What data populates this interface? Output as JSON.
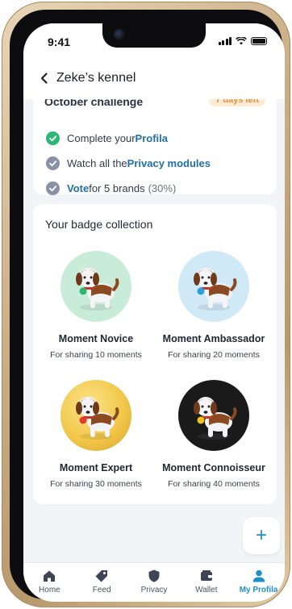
{
  "status_bar": {
    "time": "9:41"
  },
  "header": {
    "title": "Zeke’s kennel",
    "back_icon": "chevron-left-icon"
  },
  "challenge": {
    "title": "October challenge",
    "days_left": "7 days left",
    "tasks": [
      {
        "before": "Complete your ",
        "highlight": "Profila",
        "after": "",
        "extra": "",
        "done": true
      },
      {
        "before": "Watch all the ",
        "highlight": "Privacy modules",
        "after": "",
        "extra": "",
        "done": false
      },
      {
        "before": "",
        "highlight": "Vote",
        "after": " for 5 brands",
        "extra": "(30%)",
        "done": false
      }
    ]
  },
  "badges": {
    "title": "Your badge collection",
    "items": [
      {
        "name": "Moment Novice",
        "desc": "For sharing 10 moments",
        "bg": "#c9ecd9",
        "tag_color": "#2bb673"
      },
      {
        "name": "Moment Ambassador",
        "desc": "For sharing 20 moments",
        "bg": "#cfe9f7",
        "tag_color": "#2b9fd9"
      },
      {
        "name": "Moment Expert",
        "desc": "For sharing 30 moments",
        "bg": "#f2c84a",
        "tag_color": "#e53935"
      },
      {
        "name": "Moment Connoisseur",
        "desc": "For sharing 40 moments",
        "bg": "#1a1a1a",
        "tag_color": "#f2c21b"
      }
    ]
  },
  "fab": {
    "label": "+"
  },
  "nav": {
    "items": [
      {
        "label": "Home",
        "icon": "home-icon",
        "active": false
      },
      {
        "label": "Feed",
        "icon": "tag-icon",
        "active": false
      },
      {
        "label": "Privacy",
        "icon": "shield-icon",
        "active": false
      },
      {
        "label": "Wallet",
        "icon": "wallet-icon",
        "active": false
      },
      {
        "label": "My Profila",
        "icon": "user-icon",
        "active": true
      }
    ]
  },
  "colors": {
    "accent": "#1f8fc9",
    "done": "#2bb673",
    "pending": "#8a90a6",
    "link": "#1f6fa8"
  }
}
